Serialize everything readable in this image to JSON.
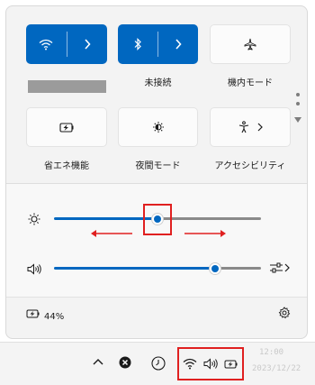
{
  "tiles": {
    "wifi": {
      "state": "on"
    },
    "bluetooth": {
      "label": "未接続",
      "state": "on"
    },
    "airplane": {
      "label": "機内モード",
      "state": "off"
    },
    "battery_saver": {
      "label": "省エネ機能",
      "state": "off"
    },
    "night_light": {
      "label": "夜間モード",
      "state": "off"
    },
    "accessibility": {
      "label": "アクセシビリティ",
      "state": "off"
    }
  },
  "sliders": {
    "brightness": {
      "value": 0.5
    },
    "volume": {
      "value": 0.78
    }
  },
  "status": {
    "battery_percent": "44%"
  },
  "taskbar": {
    "time": "12:00",
    "date": "2023/12/22"
  },
  "colors": {
    "accent": "#0067c0",
    "highlight": "#e02020"
  }
}
